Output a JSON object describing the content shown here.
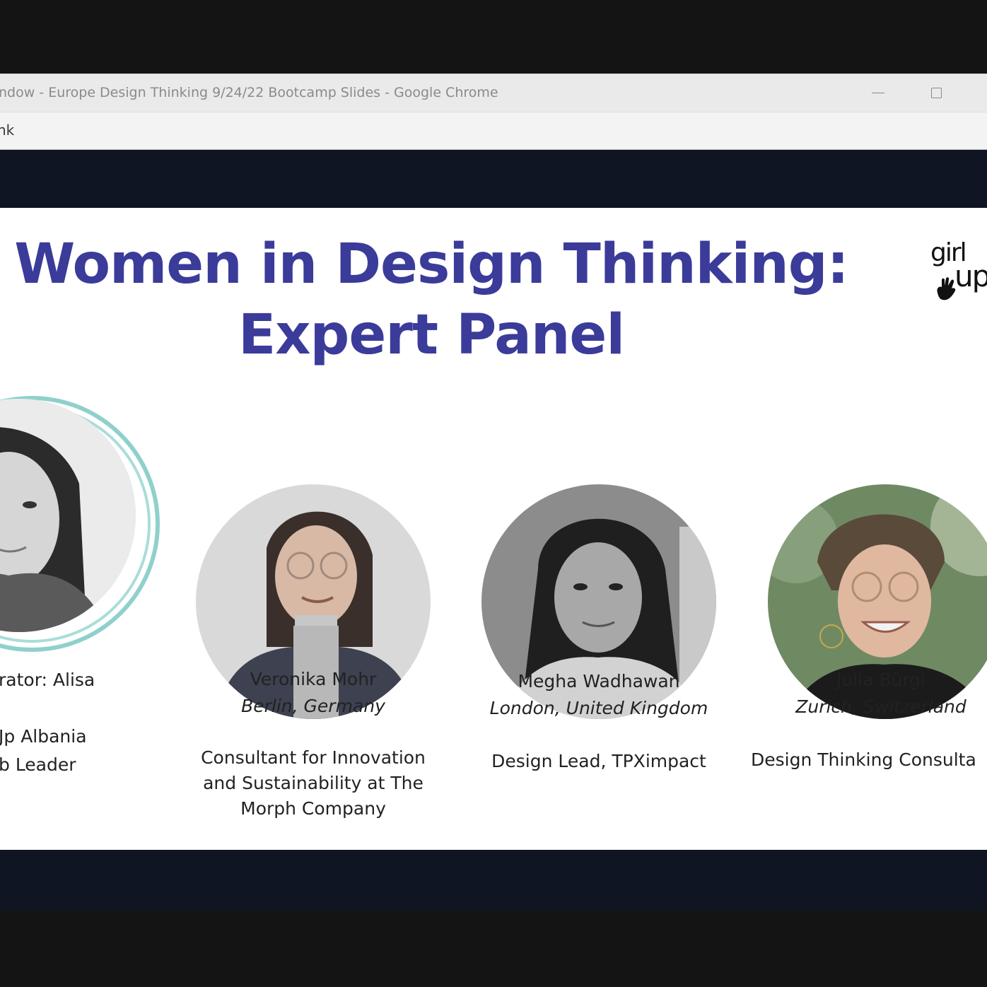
{
  "window": {
    "title": "ndow - Europe Design Thinking 9/24/22 Bootcamp Slides - Google Chrome",
    "address": "nk"
  },
  "slide": {
    "title_line1": "Women in Design Thinking:",
    "title_line2": "Expert Panel",
    "logo": {
      "line1": "girl",
      "line2": "up"
    }
  },
  "moderator": {
    "line1": "rator: Alisa",
    "line2": "Jp Albania",
    "line3": "b Leader"
  },
  "panelists": [
    {
      "name": "Veronika Mohr",
      "location": "Berlin, Germany",
      "role": "Consultant for Innovation and Sustainability at The Morph Company"
    },
    {
      "name": "Megha Wadhawan",
      "location": "London, United Kingdom",
      "role": "Design Lead, TPXimpact"
    },
    {
      "name": "Julia Bürgi",
      "location": "Zurich, Switzerland",
      "role": "Design Thinking Consulta"
    }
  ],
  "colors": {
    "title": "#3b3b9a",
    "accent_ring": "#8fd0cc",
    "frame": "#0f1522"
  }
}
